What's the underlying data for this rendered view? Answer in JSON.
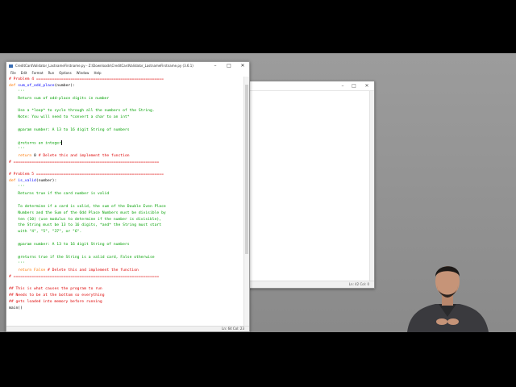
{
  "editor": {
    "title": "CreditCardValidator_LastnameFirstname.py - Z:\\Downloads\\CreditCardValidator_LastnameFirstname.py (3.6.1)",
    "menu": [
      "File",
      "Edit",
      "Format",
      "Run",
      "Options",
      "Window",
      "Help"
    ],
    "status": "Ln: 64   Col: 23",
    "lines": [
      [
        [
          "cm",
          "# Problem 4 ========================================================"
        ]
      ],
      [
        [
          "kw",
          "def "
        ],
        [
          "df",
          "sum_of_odd_place"
        ],
        [
          "",
          "(number):"
        ]
      ],
      [
        [
          "st",
          "    '''"
        ]
      ],
      [
        [
          "st",
          "    Return sum of odd-place digits in number"
        ]
      ],
      [
        [
          "st",
          ""
        ]
      ],
      [
        [
          "st",
          "    Use a *loop* to cycle through all the numbers of the String."
        ]
      ],
      [
        [
          "st",
          "    Note: You will need to *convert a char to an int*"
        ]
      ],
      [
        [
          "st",
          ""
        ]
      ],
      [
        [
          "st",
          "    @param number: A 13 to 16 digit String of numbers"
        ]
      ],
      [
        [
          "st",
          ""
        ]
      ],
      [
        [
          "st",
          "    @returns an integer"
        ]
      ],
      [
        [
          "st",
          "    '''"
        ]
      ],
      [
        [
          "kw",
          "    return "
        ],
        [
          "",
          "0 "
        ],
        [
          "cm",
          "# Delete this and implement the function"
        ]
      ],
      [
        [
          "cm",
          "# ================================================================"
        ]
      ],
      [
        [
          "",
          ""
        ]
      ],
      [
        [
          "cm",
          "# Problem 5 ========================================================"
        ]
      ],
      [
        [
          "kw",
          "def "
        ],
        [
          "df",
          "is_valid"
        ],
        [
          "",
          "(number):"
        ]
      ],
      [
        [
          "st",
          "    '''"
        ]
      ],
      [
        [
          "st",
          "    Returns true if the card number is valid"
        ]
      ],
      [
        [
          "st",
          ""
        ]
      ],
      [
        [
          "st",
          "    To determine if a card is valid, the sum of the Double Even Place"
        ]
      ],
      [
        [
          "st",
          "    Numbers and the Sum of the Odd Place Numbers must be divisible by"
        ]
      ],
      [
        [
          "st",
          "    ten (10) (use modulus to determine if the number is divisible),"
        ]
      ],
      [
        [
          "st",
          "    the String must be 13 to 16 digits, *and* the String must start"
        ]
      ],
      [
        [
          "st",
          "    with \"4\", \"5\", \"37\", or \"6\"."
        ]
      ],
      [
        [
          "st",
          ""
        ]
      ],
      [
        [
          "st",
          "    @param number: A 13 to 16 digit String of numbers"
        ]
      ],
      [
        [
          "st",
          ""
        ]
      ],
      [
        [
          "st",
          "    @returns true if the String is a valid card, False otherwise"
        ]
      ],
      [
        [
          "st",
          "    '''"
        ]
      ],
      [
        [
          "kw",
          "    return "
        ],
        [
          "kw",
          "False "
        ],
        [
          "cm",
          "# Delete this and implement the function"
        ]
      ],
      [
        [
          "cm",
          "# ================================================================"
        ]
      ],
      [
        [
          "",
          ""
        ]
      ],
      [
        [
          "cm",
          "## This is what causes the program to run"
        ]
      ],
      [
        [
          "cm",
          "## Needs to be at the bottom so everything"
        ]
      ],
      [
        [
          "cm",
          "## gets loaded into memory before running"
        ]
      ],
      [
        [
          "",
          "main()"
        ]
      ]
    ]
  },
  "shell": {
    "status": "Ln: 42   Col: 0"
  },
  "controls": {
    "minimize": "–",
    "maximize": "□",
    "close": "✕"
  }
}
